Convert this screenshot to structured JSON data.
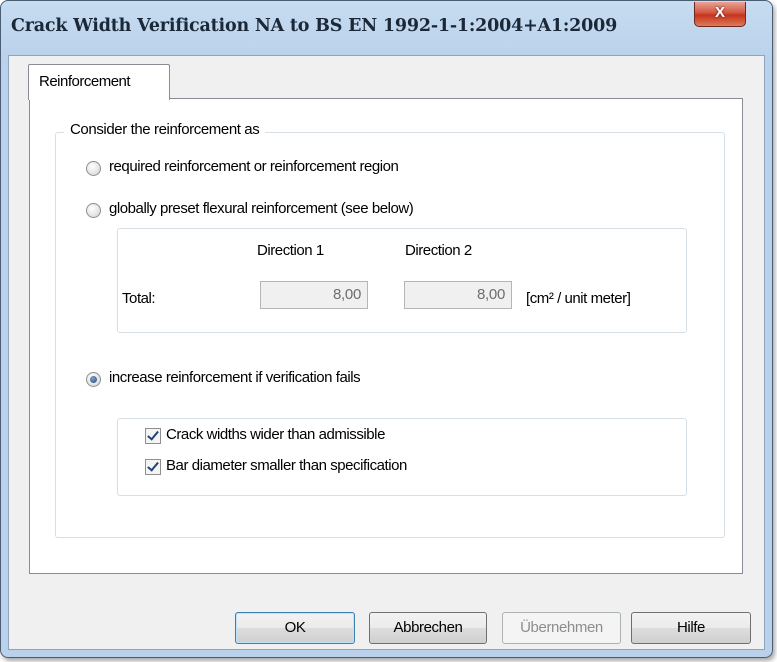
{
  "window": {
    "title": "Crack Width Verification NA to BS EN 1992-1-1:2004+A1:2009",
    "close_label": "X"
  },
  "tabs": [
    {
      "label": "Reinforcement",
      "selected": true
    }
  ],
  "group": {
    "legend": "Consider the reinforcement as",
    "options": [
      {
        "label": "required reinforcement or reinforcement region",
        "checked": false
      },
      {
        "label": "globally preset flexural reinforcement (see below)",
        "checked": false
      },
      {
        "label": "increase reinforcement if verification fails",
        "checked": true
      }
    ]
  },
  "preset": {
    "col1_header": "Direction 1",
    "col2_header": "Direction 2",
    "row_label": "Total:",
    "direction1_value": "8,00",
    "direction2_value": "8,00",
    "unit": "[cm² / unit meter]"
  },
  "criteria": {
    "items": [
      {
        "label": "Crack widths wider than admissible",
        "checked": true
      },
      {
        "label": "Bar diameter smaller than specification",
        "checked": true
      }
    ]
  },
  "buttons": {
    "ok": "OK",
    "cancel": "Abbrechen",
    "apply": "Übernehmen",
    "help": "Hilfe"
  }
}
